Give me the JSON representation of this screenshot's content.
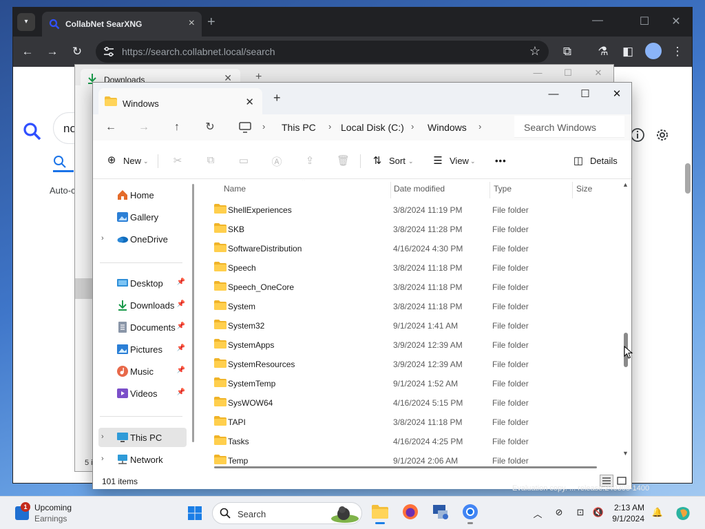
{
  "browser": {
    "tab_title": "CollabNet SearXNG",
    "url_host": "https://search.collabnet.local",
    "url_path": "/search",
    "search_query": "no",
    "autocomplete_label": "Auto-c"
  },
  "downloads_window": {
    "tab_title": "Downloads",
    "item_count": "5 i"
  },
  "explorer": {
    "tab_title": "Windows",
    "breadcrumb": [
      "This PC",
      "Local Disk (C:)",
      "Windows"
    ],
    "search_placeholder": "Search Windows",
    "commands": {
      "new": "New",
      "sort": "Sort",
      "view": "View",
      "more": "•••",
      "details": "Details"
    },
    "columns": [
      "Name",
      "Date modified",
      "Type",
      "Size"
    ],
    "sidebar": [
      {
        "label": "Home",
        "icon": "home-icon",
        "chevron": false,
        "pinned": false
      },
      {
        "label": "Gallery",
        "icon": "gallery-icon",
        "chevron": false,
        "pinned": false
      },
      {
        "label": "OneDrive",
        "icon": "onedrive-icon",
        "chevron": true,
        "pinned": false
      },
      {
        "label": "Desktop",
        "icon": "desktop-icon",
        "chevron": false,
        "pinned": true
      },
      {
        "label": "Downloads",
        "icon": "downloads-icon",
        "chevron": false,
        "pinned": true
      },
      {
        "label": "Documents",
        "icon": "documents-icon",
        "chevron": false,
        "pinned": true
      },
      {
        "label": "Pictures",
        "icon": "pictures-icon",
        "chevron": false,
        "pinned": true
      },
      {
        "label": "Music",
        "icon": "music-icon",
        "chevron": false,
        "pinned": true
      },
      {
        "label": "Videos",
        "icon": "videos-icon",
        "chevron": false,
        "pinned": true
      },
      {
        "label": "This PC",
        "icon": "this-pc-icon",
        "chevron": true,
        "pinned": false,
        "selected": true
      },
      {
        "label": "Network",
        "icon": "network-icon",
        "chevron": true,
        "pinned": false
      }
    ],
    "files": [
      {
        "name": "ShellExperiences",
        "date": "3/8/2024 11:19 PM",
        "type": "File folder"
      },
      {
        "name": "SKB",
        "date": "3/8/2024 11:28 PM",
        "type": "File folder"
      },
      {
        "name": "SoftwareDistribution",
        "date": "4/16/2024 4:30 PM",
        "type": "File folder"
      },
      {
        "name": "Speech",
        "date": "3/8/2024 11:18 PM",
        "type": "File folder"
      },
      {
        "name": "Speech_OneCore",
        "date": "3/8/2024 11:18 PM",
        "type": "File folder"
      },
      {
        "name": "System",
        "date": "3/8/2024 11:18 PM",
        "type": "File folder"
      },
      {
        "name": "System32",
        "date": "9/1/2024 1:41 AM",
        "type": "File folder"
      },
      {
        "name": "SystemApps",
        "date": "3/9/2024 12:39 AM",
        "type": "File folder"
      },
      {
        "name": "SystemResources",
        "date": "3/9/2024 12:39 AM",
        "type": "File folder"
      },
      {
        "name": "SystemTemp",
        "date": "9/1/2024 1:52 AM",
        "type": "File folder"
      },
      {
        "name": "SysWOW64",
        "date": "4/16/2024 5:15 PM",
        "type": "File folder"
      },
      {
        "name": "TAPI",
        "date": "3/8/2024 11:18 PM",
        "type": "File folder"
      },
      {
        "name": "Tasks",
        "date": "4/16/2024 4:25 PM",
        "type": "File folder"
      },
      {
        "name": "Temp",
        "date": "9/1/2024 2:06 AM",
        "type": "File folder"
      }
    ],
    "status_count": "101 items"
  },
  "desktop": {
    "watermark": "Evaluation copy. ... release.240308-1400"
  },
  "taskbar": {
    "widget_title": "Upcoming",
    "widget_subtitle": "Earnings",
    "widget_badge": "1",
    "search_label": "Search",
    "time": "2:13 AM",
    "date": "9/1/2024"
  }
}
